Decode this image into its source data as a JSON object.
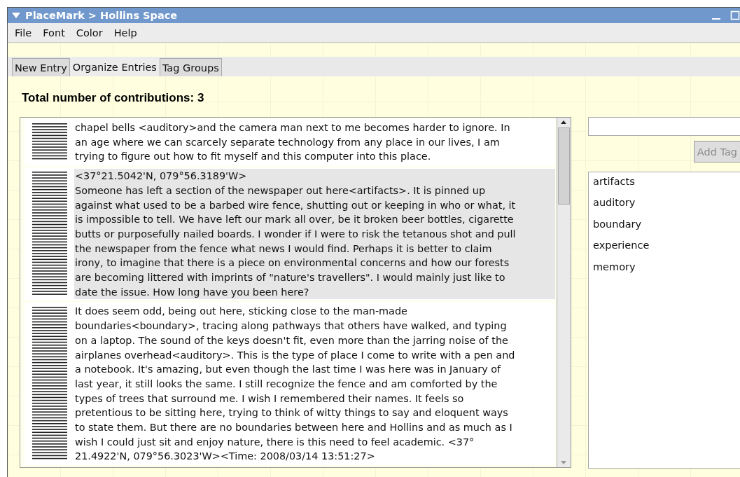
{
  "window": {
    "title": "PlaceMark > Hollins Space"
  },
  "menu": [
    "File",
    "Font",
    "Color",
    "Help"
  ],
  "tabs": [
    {
      "label": "New Entry",
      "selected": false
    },
    {
      "label": "Organize Entries",
      "selected": true
    },
    {
      "label": "Tag Groups",
      "selected": false
    }
  ],
  "heading": "Total number of contributions: 3",
  "entries": [
    {
      "selected": false,
      "lines": [
        "chapel bells <auditory>and the camera man next to me becomes harder to ignore. In",
        "an age where we can scarcely separate technology from any place in our lives, I am",
        "trying to figure out how to fit myself and this computer into this place."
      ]
    },
    {
      "selected": true,
      "lines": [
        "<37°21.5042'N, 079°56.3189'W>",
        "Someone has left a section of the newspaper out here<artifacts>. It is pinned up",
        "against what used to be a barbed wire fence, shutting out or keeping in who or what, it",
        "is impossible to tell. We have left our mark all over, be it broken beer bottles, cigarette",
        "butts or purposefully nailed boards. I wonder if I were to risk the tetanous shot and pull",
        "the newspaper from the fence what news I would find. Perhaps it is better to claim",
        "irony, to imagine that there is a piece on environmental concerns and how our forests",
        "are becoming littered with imprints of \"nature's travellers\". I would mainly just like to",
        "date the issue. How long have you been here?"
      ]
    },
    {
      "selected": false,
      "lines": [
        "It does seem odd, being out here, sticking close to the man-made",
        "boundaries<boundary>, tracing along pathways that others have walked, and typing",
        "on a laptop. The sound of the keys doesn't fit, even more than the jarring noise of the",
        "airplanes overhead<auditory>. This is the type of place I come to write with a pen and",
        "a notebook. It's amazing, but even though the last time I was here was in January of",
        "last year, it still looks the same. I still recognize the fence and am comforted by the",
        "types of trees that surround me. I wish I remembered their names. It feels so",
        "pretentious to be sitting here, trying to think of witty things to say and eloquent ways",
        "to state them. But there are no boundaries between here and Hollins and as much as I",
        "wish I could just sit and enjoy nature, there is this need to feel academic. <37°",
        "21.4922'N, 079°56.3023'W><Time: 2008/03/14 13:51:27>"
      ]
    }
  ],
  "add_tag_button": {
    "label": "Add Tag",
    "disabled": true
  },
  "tags": [
    "artifacts",
    "auditory",
    "boundary",
    "experience",
    "memory"
  ]
}
